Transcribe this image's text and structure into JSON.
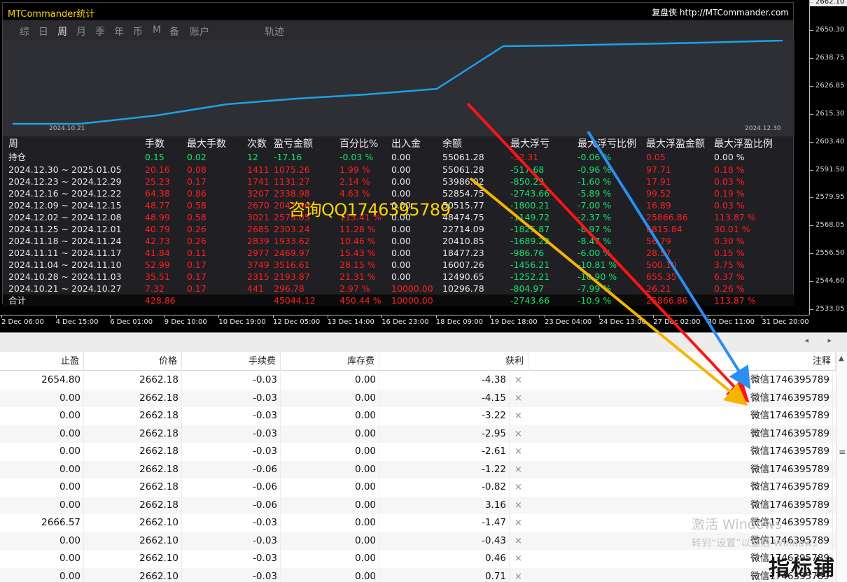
{
  "chart": {
    "price_ticks": [
      {
        "label": "2662.10",
        "current": true
      },
      {
        "label": "2650.30"
      },
      {
        "label": "2638.75"
      },
      {
        "label": "2626.85"
      },
      {
        "label": "2615.30"
      },
      {
        "label": "2603.40"
      },
      {
        "label": "2591.50"
      },
      {
        "label": "2579.95"
      },
      {
        "label": "2568.05"
      },
      {
        "label": "2556.50"
      },
      {
        "label": "2544.60"
      },
      {
        "label": "2533.05"
      }
    ],
    "time_ticks": [
      "2 Dec 06:00",
      "4 Dec 15:00",
      "6 Dec 01:00",
      "9 Dec 10:00",
      "10 Dec 19:00",
      "12 Dec 05:00",
      "13 Dec 14:00",
      "16 Dec 23:00",
      "18 Dec 09:00",
      "19 Dec 18:00",
      "23 Dec 04:00",
      "24 Dec 13:00",
      "27 Dec 02:00",
      "30 Dec 11:00",
      "31 Dec 20:00"
    ]
  },
  "panel": {
    "title": "MTCommander统计",
    "brand": "复盘侠 http://MTCommander.com",
    "tabs": [
      "综",
      "日",
      "周",
      "月",
      "季",
      "年",
      "币",
      "M",
      "备",
      "账户",
      "轨迹"
    ],
    "active_tab": "周",
    "equity_start_date": "2024.10.21",
    "equity_end_date": "2024.12.30",
    "overlay_text": "咨询QQ1746395789"
  },
  "stats": {
    "headers": [
      "周",
      "手数",
      "最大手数",
      "次数",
      "盈亏金额",
      "百分比%",
      "出入金",
      "余额",
      "最大浮亏",
      "最大浮亏比例",
      "最大浮盈金额",
      "最大浮盈比例"
    ],
    "holding": [
      "持仓",
      "0.15",
      "0.02",
      "12",
      "-17.16",
      "-0.03 %",
      "0.00",
      "55061.28",
      "-32.31",
      "-0.06 %",
      "0.05",
      "0.00 %"
    ],
    "rows": [
      [
        "2024.12.30 ~ 2025.01.05",
        "20.16",
        "0.08",
        "1411",
        "1075.26",
        "1.99 %",
        "0.00",
        "55061.28",
        "-517.68",
        "-0.96 %",
        "97.71",
        "0.18 %"
      ],
      [
        "2024.12.23 ~ 2024.12.29",
        "25.23",
        "0.17",
        "1741",
        "1131.27",
        "2.14 %",
        "0.00",
        "53986.02",
        "-850.29",
        "-1.60 %",
        "17.91",
        "0.03 %"
      ],
      [
        "2024.12.16 ~ 2024.12.22",
        "64.38",
        "0.86",
        "3207",
        "2338.98",
        "4.63 %",
        "0.00",
        "52854.75",
        "-2743.66",
        "-5.89 %",
        "99.52",
        "0.19 %"
      ],
      [
        "2024.12.09 ~ 2024.12.15",
        "48.77",
        "0.58",
        "2670",
        "2047.36",
        "",
        "0.00",
        "50515.77",
        "-1800.21",
        "-7.00 %",
        "16.89",
        "0.03 %"
      ],
      [
        "2024.12.02 ~ 2024.12.08",
        "48.99",
        "0.58",
        "3021",
        "2573.05",
        "113.41 %",
        "0.00",
        "48474.75",
        "-1149.72",
        "-2.37 %",
        "25866.86",
        "113.87 %"
      ],
      [
        "2024.11.25 ~ 2024.12.01",
        "40.79",
        "0.26",
        "2685",
        "2303.24",
        "11.28 %",
        "0.00",
        "22714.09",
        "-1825.87",
        "-8.97 %",
        "6815.84",
        "30.01 %"
      ],
      [
        "2024.11.18 ~ 2024.11.24",
        "42.73",
        "0.26",
        "2839",
        "1933.62",
        "10.46 %",
        "0.00",
        "20410.85",
        "-1689.22",
        "-8.47 %",
        "56.79",
        "0.30 %"
      ],
      [
        "2024.11.11 ~ 2024.11.17",
        "41.84",
        "0.11",
        "2977",
        "2469.97",
        "15.43 %",
        "0.00",
        "18477.23",
        "-986.76",
        "-6.00 %",
        "28.57",
        "0.15 %"
      ],
      [
        "2024.11.04 ~ 2024.11.10",
        "52.99",
        "0.17",
        "3749",
        "3516.61",
        "28.15 %",
        "0.00",
        "16007.26",
        "-1456.21",
        "-10.81 %",
        "500.10",
        "3.75 %"
      ],
      [
        "2024.10.28 ~ 2024.11.03",
        "35.51",
        "0.17",
        "2315",
        "2193.87",
        "21.31 %",
        "0.00",
        "12490.65",
        "-1252.21",
        "-10.90 %",
        "655.35",
        "6.37 %"
      ],
      [
        "2024.10.21 ~ 2024.10.27",
        "7.32",
        "0.17",
        "441",
        "296.78",
        "2.97 %",
        "10000.00",
        "10296.78",
        "-804.97",
        "-7.99 %",
        "26.21",
        "0.26 %"
      ]
    ],
    "total": [
      "合计",
      "428.86",
      "",
      "",
      "45044.12",
      "450.44 %",
      "10000.00",
      "",
      "-2743.66",
      "-10.9 %",
      "25866.86",
      "113.87 %"
    ]
  },
  "terminal": {
    "headers": [
      "止盈",
      "价格",
      "手续费",
      "库存费",
      "获利",
      "注释"
    ],
    "rows": [
      [
        "2654.80",
        "2662.18",
        "-0.03",
        "0.00",
        "-4.38",
        "微信1746395789"
      ],
      [
        "0.00",
        "2662.18",
        "-0.03",
        "0.00",
        "-4.15",
        "微信1746395789"
      ],
      [
        "0.00",
        "2662.18",
        "-0.03",
        "0.00",
        "-3.22",
        "微信1746395789"
      ],
      [
        "0.00",
        "2662.18",
        "-0.03",
        "0.00",
        "-2.95",
        "微信1746395789"
      ],
      [
        "0.00",
        "2662.18",
        "-0.03",
        "0.00",
        "-2.61",
        "微信1746395789"
      ],
      [
        "0.00",
        "2662.18",
        "-0.06",
        "0.00",
        "-1.22",
        "微信1746395789"
      ],
      [
        "0.00",
        "2662.18",
        "-0.06",
        "0.00",
        "-0.82",
        "微信1746395789"
      ],
      [
        "0.00",
        "2662.18",
        "-0.06",
        "0.00",
        "3.16",
        "微信1746395789"
      ],
      [
        "2666.57",
        "2662.10",
        "-0.03",
        "0.00",
        "-1.47",
        "微信1746395789"
      ],
      [
        "0.00",
        "2662.10",
        "-0.03",
        "0.00",
        "-0.43",
        "微信1746395789"
      ],
      [
        "0.00",
        "2662.10",
        "-0.03",
        "0.00",
        "0.46",
        "微信1746395789"
      ],
      [
        "0.00",
        "2662.10",
        "-0.03",
        "0.00",
        "0.71",
        "微信1746395789"
      ]
    ],
    "close_glyph": "×",
    "scroll_up_glyph": "▲",
    "scroll_grip_glyph": "≡",
    "hscroll_glyphs": "◂ ▸"
  },
  "watermark": {
    "line1": "激活 Windows",
    "line2": "转到“设置”以激活 Windows",
    "site_logo": "指标铺"
  },
  "colors": {
    "positive": "#12e66b",
    "negative": "#ff1f1f",
    "equity_line": "#1aa3e8",
    "arrow_red": "#ff1414",
    "arrow_blue": "#2b8ef0",
    "arrow_yellow": "#f5b400"
  }
}
